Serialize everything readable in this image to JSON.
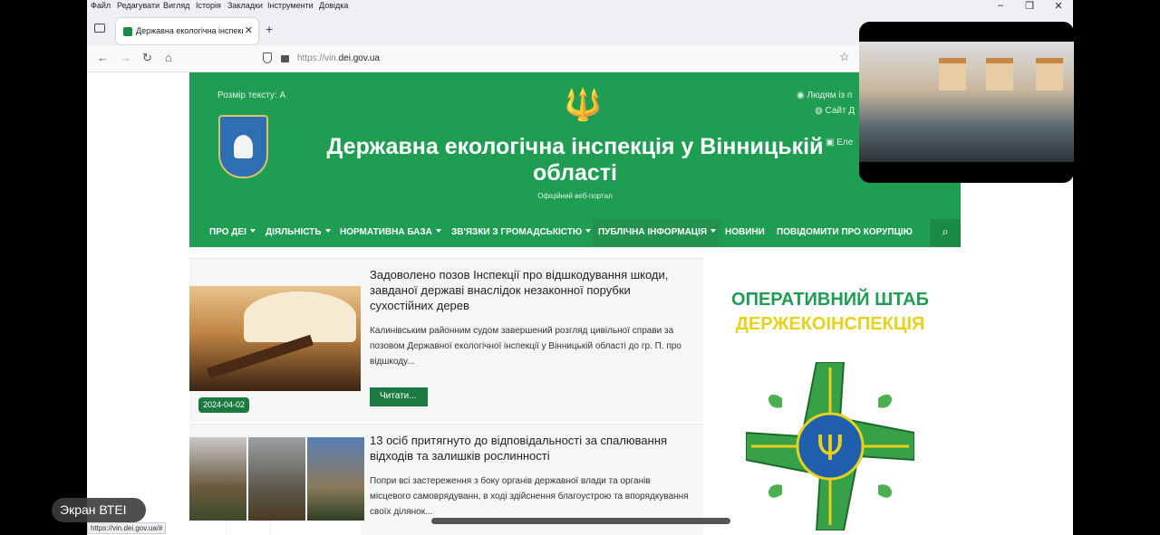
{
  "menubar": [
    "Файл",
    "Редагувати",
    "Вигляд",
    "Історія",
    "Закладки",
    "Інструменти",
    "Довідка"
  ],
  "tab": {
    "title": "Державна екологічна інспекц"
  },
  "address": {
    "prefix": "https://vin.",
    "domain": "dei.gov.ua"
  },
  "header": {
    "text_size": "Розмір тексту: A",
    "title": "Державна екологічна інспекція у Вінницькій області",
    "subtitle": "Офіційний веб-портал",
    "top_links": [
      "Людям із п",
      "Сайт Д",
      "Еле"
    ]
  },
  "nav": [
    {
      "label": "ПРО ДЕІ",
      "dropdown": true
    },
    {
      "label": "ДІЯЛЬНІСТЬ",
      "dropdown": true
    },
    {
      "label": "НОРМАТИВНА БАЗА",
      "dropdown": true
    },
    {
      "label": "ЗВ'ЯЗКИ З ГРОМАДСЬКІСТЮ",
      "dropdown": true
    },
    {
      "label": "ПУБЛІЧНА ІНФОРМАЦІЯ",
      "dropdown": true
    },
    {
      "label": "НОВИНИ",
      "dropdown": false
    },
    {
      "label": "ПОВІДОМИТИ ПРО КОРУПЦІЮ",
      "dropdown": false
    }
  ],
  "news": [
    {
      "title": "Задоволено позов Інспекції про відшкодування шкоди, завданої державі внаслідок незаконної порубки сухостійних дерев",
      "text": "Калинівським районним судом завершений розгляд цивільної справи за позовом Державної екологічної інспекції у Вінницькій області до гр. П. про відшкоду...",
      "date": "2024-04-02",
      "read_label": "Читати..."
    },
    {
      "title": "13 осіб притягнуто до відповідальності за спалювання відходів та залишків рослинності",
      "text": "Попри всі застереження з боку органів державної влади та органів місцевого самоврядуванн, в ході здійснення благоустрою та впорядкування своїх ділянок..."
    }
  ],
  "banner": {
    "line1": "ОПЕРАТИВНИЙ ШТАБ",
    "line2": "ДЕРЖЕКОІНСПЕКЦІЯ"
  },
  "status_url": "https://vin.dei.gov.ua/#",
  "overlay_label": "Экран ВТЕІ",
  "colors": {
    "brand_green": "#1f9d52",
    "button_green": "#1b7a40",
    "banner_yellow": "#e6d21c"
  }
}
